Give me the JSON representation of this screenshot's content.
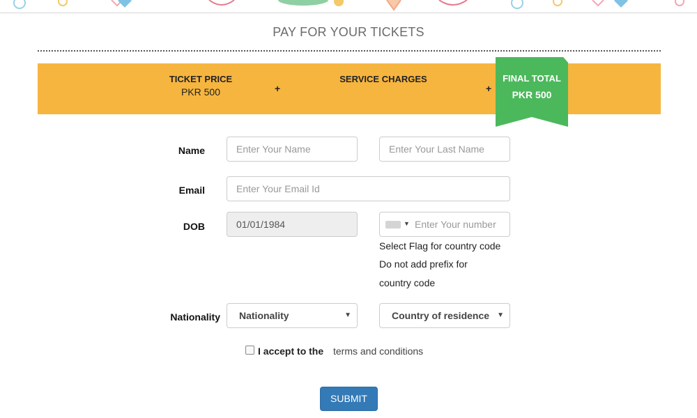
{
  "page": {
    "title": "PAY FOR YOUR TICKETS"
  },
  "price_summary": {
    "ticket_price_label": "TICKET PRICE",
    "ticket_price_value": "PKR 500",
    "plus_symbol": "+",
    "service_charges_label": "SERVICE CHARGES",
    "final_total_label": "FINAL TOTAL",
    "final_total_value": "PKR 500",
    "bar_color": "#f6b53f",
    "ribbon_color": "#4cb85c"
  },
  "form": {
    "name_label": "Name",
    "first_name_placeholder": "Enter Your Name",
    "last_name_placeholder": "Enter Your Last Name",
    "email_label": "Email",
    "email_placeholder": "Enter Your Email Id",
    "dob_label": "DOB",
    "dob_value": "01/01/1984",
    "phone_placeholder": "Enter Your number",
    "phone_flag_icon": "flag-icon",
    "help_line_1": "Select Flag for country code",
    "help_line_2": "Do not add prefix for",
    "help_line_3": "country code",
    "nationality_label": "Nationality",
    "nationality_select_value": "Nationality",
    "residence_select_value": "Country of residence",
    "terms_bold": "I accept to the",
    "terms_link": "terms and conditions",
    "submit_label": "SUBMIT",
    "submit_color": "#337ab7"
  }
}
